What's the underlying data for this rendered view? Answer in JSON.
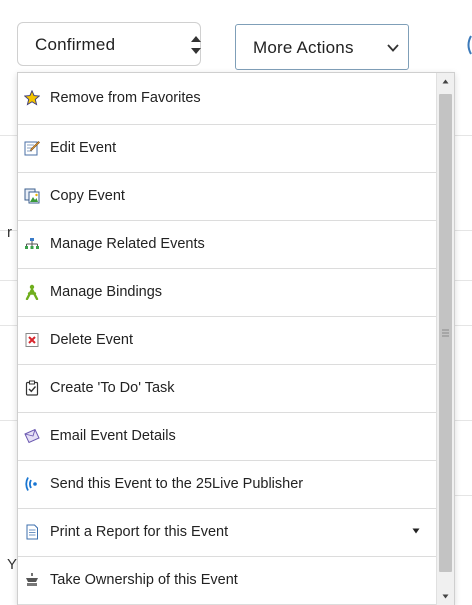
{
  "toolbar": {
    "status_select": {
      "value": "Confirmed"
    },
    "more_actions": {
      "label": "More Actions"
    }
  },
  "menu": {
    "items": [
      {
        "label": "Remove from Favorites",
        "icon": "star-icon"
      },
      {
        "label": "Edit Event",
        "icon": "edit-icon"
      },
      {
        "label": "Copy Event",
        "icon": "copy-icon"
      },
      {
        "label": "Manage Related Events",
        "icon": "hierarchy-icon"
      },
      {
        "label": "Manage Bindings",
        "icon": "bindings-icon"
      },
      {
        "label": "Delete Event",
        "icon": "delete-icon"
      },
      {
        "label": "Create 'To Do' Task",
        "icon": "todo-icon"
      },
      {
        "label": "Email Event Details",
        "icon": "email-icon"
      },
      {
        "label": "Send this Event to the 25Live Publisher",
        "icon": "broadcast-icon"
      },
      {
        "label": "Print a Report for this Event",
        "icon": "report-icon",
        "has_submenu": true
      },
      {
        "label": "Take Ownership of this Event",
        "icon": "ownership-icon"
      }
    ]
  },
  "background": {
    "partial_chars": [
      "r",
      "Y"
    ]
  },
  "colors": {
    "border": "#d0d0d0",
    "button_border": "#7f9fb8",
    "star": "#f4c400",
    "delete_red": "#d8262c",
    "manage_bindings_green": "#6fae1d",
    "broadcast_blue": "#1976d2",
    "scroll_thumb": "#c3c3c3"
  }
}
